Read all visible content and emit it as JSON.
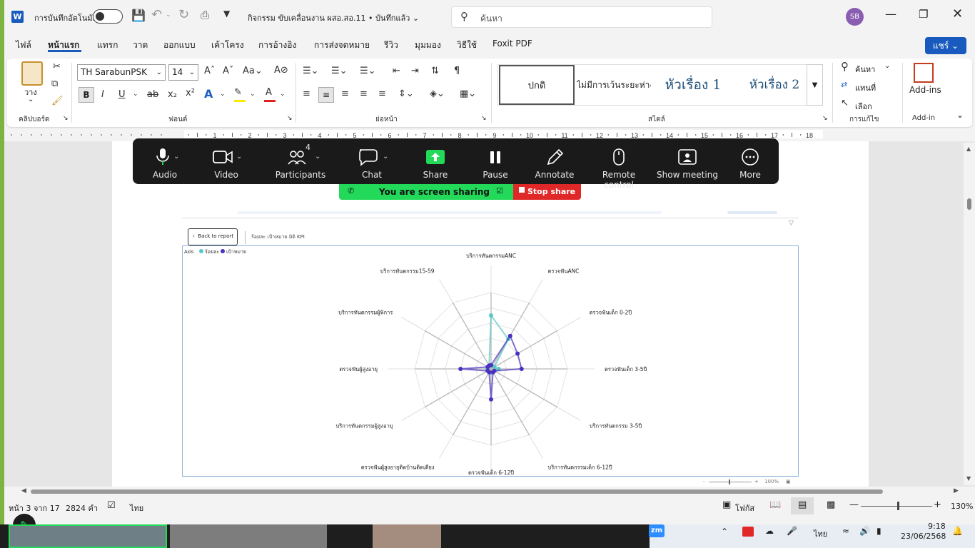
{
  "titlebar": {
    "autosave_label": "การบันทึกอัตโนมัติ",
    "doc_title": "กิจกรรม ขับเคลื่อนงาน ผสอ.สอ.11 • บันทึกแล้ว ⌄",
    "search_placeholder": "ค้นหา",
    "user_initials": "SB"
  },
  "menu": {
    "items": [
      "ไฟล์",
      "หน้าแรก",
      "แทรก",
      "วาด",
      "ออกแบบ",
      "เค้าโครง",
      "การอ้างอิง",
      "การส่งจดหมาย",
      "รีวิว",
      "มุมมอง",
      "วิธีใช้",
      "Foxit PDF"
    ],
    "share": "แชร์ ⌄"
  },
  "ribbon": {
    "clipboard": {
      "paste": "วาง",
      "label": "คลิปบอร์ด"
    },
    "font": {
      "name": "TH SarabunPSK",
      "size": "14",
      "label": "ฟอนต์"
    },
    "paragraph": {
      "label": "ย่อหน้า"
    },
    "styles": {
      "items": [
        "ปกติ",
        "ไม่มีการเว้นระยะห่าง",
        "หัวเรื่อง 1",
        "หัวเรื่อง 2"
      ],
      "label": "สไตล์"
    },
    "editing": {
      "find": "ค้นหา",
      "replace": "แทนที่",
      "select": "เลือก",
      "label": "การแก้ไข"
    },
    "addins": {
      "button": "Add-ins",
      "label": "Add-in"
    }
  },
  "ruler": {
    "ticks": [
      "1",
      "2",
      "3",
      "4",
      "5",
      "6",
      "7",
      "8",
      "9",
      "10",
      "11",
      "12",
      "13",
      "14",
      "15",
      "16",
      "17",
      "18"
    ]
  },
  "zoom": {
    "toolbar": [
      {
        "label": "Audio",
        "icon": "microphone-icon"
      },
      {
        "label": "Video",
        "icon": "video-camera-icon"
      },
      {
        "label": "Participants",
        "icon": "participants-icon",
        "count": "4"
      },
      {
        "label": "Chat",
        "icon": "chat-icon"
      },
      {
        "label": "Share",
        "icon": "share-screen-icon"
      },
      {
        "label": "Pause",
        "icon": "pause-icon"
      },
      {
        "label": "Annotate",
        "icon": "pencil-icon"
      },
      {
        "label": "Remote control",
        "icon": "mouse-icon"
      },
      {
        "label": "Show meeting",
        "icon": "meeting-window-icon"
      },
      {
        "label": "More",
        "icon": "more-icon"
      }
    ],
    "sharing_text": "You are screen sharing",
    "stop_share": "Stop share",
    "accent": "#23d959",
    "stop_color": "#e02828"
  },
  "report": {
    "back": "Back to report",
    "title": "ร้อยละ เป้าหมาย มิติ KPI",
    "legend_axis": "Axis",
    "zoom_label": "100%"
  },
  "chart_data": {
    "type": "radar",
    "axes": [
      "บริการทันตกรรมANC",
      "ตรวจฟันANC",
      "ตรวจฟันเด็ก 0-2ปี",
      "ตรวจฟันเด็ก 3-5ปี",
      "บริการทันตกรรม 3-5ปี",
      "บริการทันตกรรมเด็ก 6-12ปี",
      "ตรวจฟันเด็ก 6-12ปี",
      "ตรวจฟันผู้สูงอายุติดบ้านติดเตียง",
      "บริการทันตกรรมผู้สูงอายุ",
      "ตรวจฟันผู้สูงอายุ",
      "บริการทันตกรรมผู้พิการ",
      "บริการทันตกรรม15-59"
    ],
    "max": 100,
    "legend_position": "top-left",
    "series": [
      {
        "name": "ร้อยละ",
        "color": "#5bc5c5",
        "values": [
          70,
          45,
          5,
          10,
          5,
          5,
          5,
          5,
          5,
          5,
          5,
          5
        ]
      },
      {
        "name": "เป้าหมาย",
        "color": "#4a2fc0",
        "values": [
          5,
          50,
          40,
          40,
          5,
          5,
          40,
          5,
          5,
          40,
          5,
          5
        ]
      }
    ]
  },
  "status": {
    "page": "หน้า 3 จาก 17",
    "words": "2824 คำ",
    "language": "ไทย",
    "focus": "โฟกัส",
    "zoom": "130%"
  },
  "taskbar": {
    "ime": "ไทย",
    "time": "9:18",
    "date": "23/06/2568",
    "zoom_app": "zm"
  }
}
